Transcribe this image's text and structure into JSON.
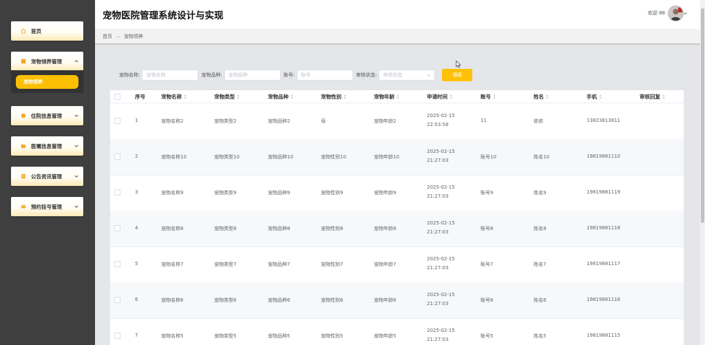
{
  "header": {
    "title": "宠物医院管理系统设计与实现",
    "welcome": "欢迎 88"
  },
  "breadcrumb": {
    "home": "首页",
    "separator": "—",
    "current": "宠物领养"
  },
  "sidebar": {
    "items": [
      {
        "label": "首页",
        "icon": "home-icon"
      },
      {
        "label": "宠物领养管理",
        "icon": "folder-icon",
        "expanded": true,
        "children": [
          {
            "label": "宠物领养"
          }
        ]
      },
      {
        "label": "住院信息管理",
        "icon": "circle-icon"
      },
      {
        "label": "医嘱信息管理",
        "icon": "folder-icon"
      },
      {
        "label": "公告资讯管理",
        "icon": "document-icon"
      },
      {
        "label": "预约挂号管理",
        "icon": "card-icon"
      }
    ]
  },
  "search": {
    "fields": [
      {
        "label": "宠物名称:",
        "placeholder": "宠物名称"
      },
      {
        "label": "宠物品种:",
        "placeholder": "宠物品种"
      },
      {
        "label": "账号:",
        "placeholder": "账号"
      },
      {
        "label": "审核状态:",
        "placeholder": "审核状态"
      }
    ],
    "button": "搜索"
  },
  "table": {
    "columns": [
      "序号",
      "宠物名称",
      "宠物类型",
      "宠物品种",
      "宠物性别",
      "宠物年龄",
      "申请时间",
      "账号",
      "姓名",
      "手机",
      "审核回复"
    ],
    "rows": [
      {
        "index": "1",
        "name": "宠物名称2",
        "type": "宠物类型2",
        "breed": "宠物品种2",
        "gender": "母",
        "age": "宠物年龄2",
        "time": "2025-02-15 22:53:58",
        "account": "11",
        "realname": "依依",
        "phone": "13823813811",
        "reply": ""
      },
      {
        "index": "2",
        "name": "宠物名称10",
        "type": "宠物类型10",
        "breed": "宠物品种10",
        "gender": "宠物性别10",
        "age": "宠物年龄10",
        "time": "2025-02-15 21:27:03",
        "account": "账号10",
        "realname": "姓名10",
        "phone": "19819881110",
        "reply": ""
      },
      {
        "index": "3",
        "name": "宠物名称9",
        "type": "宠物类型9",
        "breed": "宠物品种9",
        "gender": "宠物性别9",
        "age": "宠物年龄9",
        "time": "2025-02-15 21:27:03",
        "account": "账号9",
        "realname": "姓名9",
        "phone": "19819881119",
        "reply": ""
      },
      {
        "index": "4",
        "name": "宠物名称8",
        "type": "宠物类型8",
        "breed": "宠物品种8",
        "gender": "宠物性别8",
        "age": "宠物年龄8",
        "time": "2025-02-15 21:27:03",
        "account": "账号8",
        "realname": "姓名8",
        "phone": "19819881118",
        "reply": ""
      },
      {
        "index": "5",
        "name": "宠物名称7",
        "type": "宠物类型7",
        "breed": "宠物品种7",
        "gender": "宠物性别7",
        "age": "宠物年龄7",
        "time": "2025-02-15 21:27:03",
        "account": "账号7",
        "realname": "姓名7",
        "phone": "19819881117",
        "reply": ""
      },
      {
        "index": "6",
        "name": "宠物名称6",
        "type": "宠物类型6",
        "breed": "宠物品种6",
        "gender": "宠物性别6",
        "age": "宠物年龄6",
        "time": "2025-02-15 21:27:03",
        "account": "账号6",
        "realname": "姓名6",
        "phone": "19819881116",
        "reply": ""
      },
      {
        "index": "7",
        "name": "宠物名称5",
        "type": "宠物类型5",
        "breed": "宠物品种5",
        "gender": "宠物性别5",
        "age": "宠物年龄5",
        "time": "2025-02-15 21:27:03",
        "account": "账号5",
        "realname": "姓名5",
        "phone": "19819881115",
        "reply": ""
      }
    ]
  },
  "colors": {
    "sidebar_bg": "#3f3f3f",
    "accent": "#fbbf04",
    "menu_gradient_end": "#fde9b6"
  }
}
